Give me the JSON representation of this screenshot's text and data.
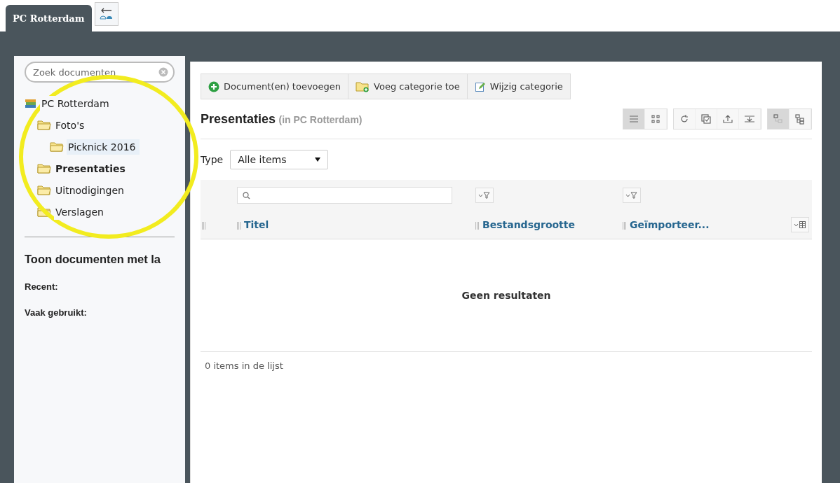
{
  "tabs": [
    {
      "label": "PC Rotterdam",
      "selected": true
    }
  ],
  "sidebar": {
    "search": {
      "placeholder": "Zoek documenten"
    },
    "tree": [
      {
        "label": "PC Rotterdam",
        "kind": "library",
        "selected": false,
        "highlighted": false,
        "children": [
          {
            "label": "Foto's",
            "kind": "folder",
            "selected": false,
            "highlighted": false,
            "children": [
              {
                "label": "Picknick 2016",
                "kind": "folder",
                "selected": false,
                "highlighted": true
              }
            ]
          },
          {
            "label": "Presentaties",
            "kind": "folder",
            "selected": true,
            "highlighted": false
          },
          {
            "label": "Uitnodigingen",
            "kind": "folder",
            "selected": false,
            "highlighted": false
          },
          {
            "label": "Verslagen",
            "kind": "folder",
            "selected": false,
            "highlighted": false
          }
        ]
      }
    ],
    "section_title": "Toon documenten met la",
    "sections": [
      "Recent:",
      "Vaak gebruikt:"
    ]
  },
  "toolbar": [
    {
      "label": "Document(en) toevoegen",
      "kind": "add"
    },
    {
      "label": "Voeg categorie toe",
      "kind": "folder-add"
    },
    {
      "label": "Wijzig categorie",
      "kind": "edit"
    }
  ],
  "heading": {
    "title": "Presentaties",
    "context": "(in PC Rotterdam)"
  },
  "view_buttons": [
    {
      "kind": "list",
      "selected": true
    },
    {
      "kind": "grid",
      "selected": false
    }
  ],
  "action_buttons": [
    {
      "kind": "refresh"
    },
    {
      "kind": "select"
    },
    {
      "kind": "upload"
    },
    {
      "kind": "collapse"
    }
  ],
  "tree_buttons": [
    {
      "kind": "tree-a",
      "selected": true
    },
    {
      "kind": "tree-b",
      "selected": false
    }
  ],
  "type_filter": {
    "label": "Type",
    "value": "Alle items"
  },
  "table": {
    "columns": [
      {
        "title": "Titel",
        "kind": "search"
      },
      {
        "title": "Bestandsgrootte",
        "kind": "dropdown"
      },
      {
        "title": "Geïmporteer...",
        "kind": "dropdown"
      }
    ],
    "empty_message": "Geen resultaten",
    "footer": "0 items in de lijst"
  },
  "annotation": {
    "kind": "circle"
  }
}
